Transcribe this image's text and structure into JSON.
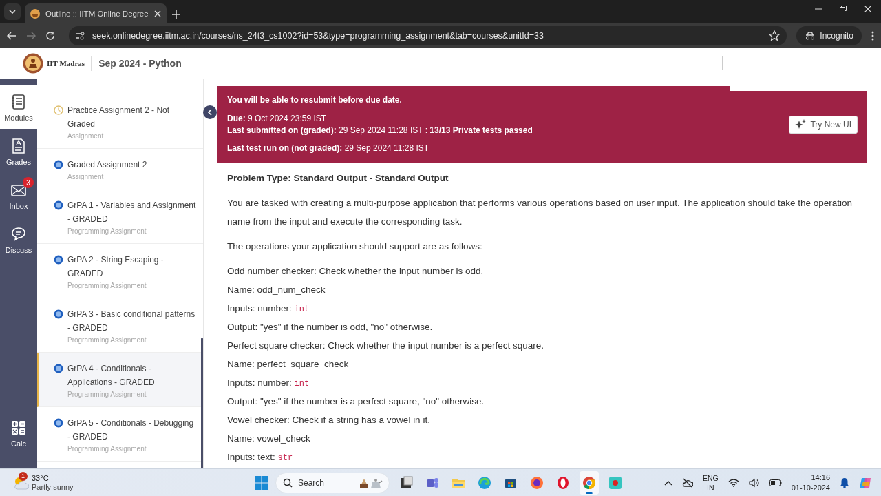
{
  "browser": {
    "tabs": [
      {
        "title": "Outline :: IITM Online Degree",
        "selected": true
      }
    ],
    "url": "seek.onlinedegree.iitm.ac.in/courses/ns_24t3_cs1002?id=53&type=programming_assignment&tab=courses&unitId=33",
    "forward_disabled": true,
    "profile": "Incognito"
  },
  "header": {
    "org": "IIT Madras",
    "course": "Sep 2024 - Python"
  },
  "rail": [
    {
      "kind": "modules",
      "label": "Modules",
      "selected": true
    },
    {
      "kind": "grades",
      "label": "Grades",
      "selected": false
    },
    {
      "kind": "inbox",
      "label": "Inbox",
      "selected": false,
      "badge": "3"
    },
    {
      "kind": "discuss",
      "label": "Discuss",
      "selected": false
    },
    {
      "kind": "calc",
      "label": "Calc",
      "selected": false
    }
  ],
  "sidebar": {
    "items": [
      {
        "kind": "clock",
        "title": "Practice Assignment 2 - Not Graded",
        "type": "Assignment",
        "selected": false
      },
      {
        "kind": "dot",
        "title": "Graded Assignment 2",
        "type": "Assignment",
        "selected": false
      },
      {
        "kind": "dot",
        "title": "GrPA 1 - Variables and Assignment - GRADED",
        "type": "Programming Assignment",
        "selected": false
      },
      {
        "kind": "dot",
        "title": "GrPA 2 - String Escaping - GRADED",
        "type": "Programming Assignment",
        "selected": false
      },
      {
        "kind": "dot",
        "title": "GrPA 3 - Basic conditional patterns - GRADED",
        "type": "Programming Assignment",
        "selected": false
      },
      {
        "kind": "dot",
        "title": "GrPA 4 - Conditionals - Applications - GRADED",
        "type": "Programming Assignment",
        "selected": true
      },
      {
        "kind": "dot",
        "title": "GrPA 5 - Conditionals - Debugging - GRADED",
        "type": "Programming Assignment",
        "selected": false
      }
    ]
  },
  "banner": {
    "notice": "You will be able to resubmit before due date.",
    "groups": [
      [
        "**Due:** 9 Oct 2024 23:59 IST",
        "**Last submitted on (graded):** 29 Sep 2024 11:28 IST : **13/13 Private tests passed**"
      ],
      [
        "**Last test run on (not graded):** 29 Sep 2024 11:28 IST"
      ]
    ],
    "button": "Try New UI"
  },
  "problem": {
    "heading": "Problem Type: Standard Output - Standard Output",
    "paragraphs": [
      "You are tasked with creating a multi-purpose application that performs various operations based on user input. The application should take the operation name from the input and execute the corresponding task.",
      "The operations your application should support are as follows:"
    ],
    "lines": [
      {
        "text": "Odd number checker: Check whether the input number is odd."
      },
      {
        "text": "Name: odd_num_check"
      },
      {
        "text": "Inputs: number: ",
        "code": "int"
      },
      {
        "text": "Output: \"yes\" if the number is odd, \"no\" otherwise."
      },
      {
        "text": "Perfect square checker: Check whether the input number is a perfect square."
      },
      {
        "text": "Name: perfect_square_check"
      },
      {
        "text": "Inputs: number: ",
        "code": "int"
      },
      {
        "text": "Output: \"yes\" if the number is a perfect square, \"no\" otherwise."
      },
      {
        "text": "Vowel checker: Check if a string has a vowel in it."
      },
      {
        "text": "Name: vowel_check"
      },
      {
        "text": "Inputs: text: ",
        "code": "str"
      }
    ]
  },
  "taskbar": {
    "weather": {
      "temp": "33°C",
      "desc": "Partly sunny",
      "badge": "1"
    },
    "search": "Search",
    "apps": [
      {
        "kind": "taskview",
        "selected": false
      },
      {
        "kind": "teams",
        "selected": false
      },
      {
        "kind": "files",
        "selected": false
      },
      {
        "kind": "edge",
        "selected": false
      },
      {
        "kind": "store",
        "selected": false
      },
      {
        "kind": "firefox",
        "selected": false
      },
      {
        "kind": "opera",
        "selected": false
      },
      {
        "kind": "chrome",
        "selected": true
      },
      {
        "kind": "recorder",
        "selected": false
      }
    ],
    "lang": [
      "ENG",
      "IN"
    ],
    "time": "14:16",
    "date": "01-10-2024"
  }
}
